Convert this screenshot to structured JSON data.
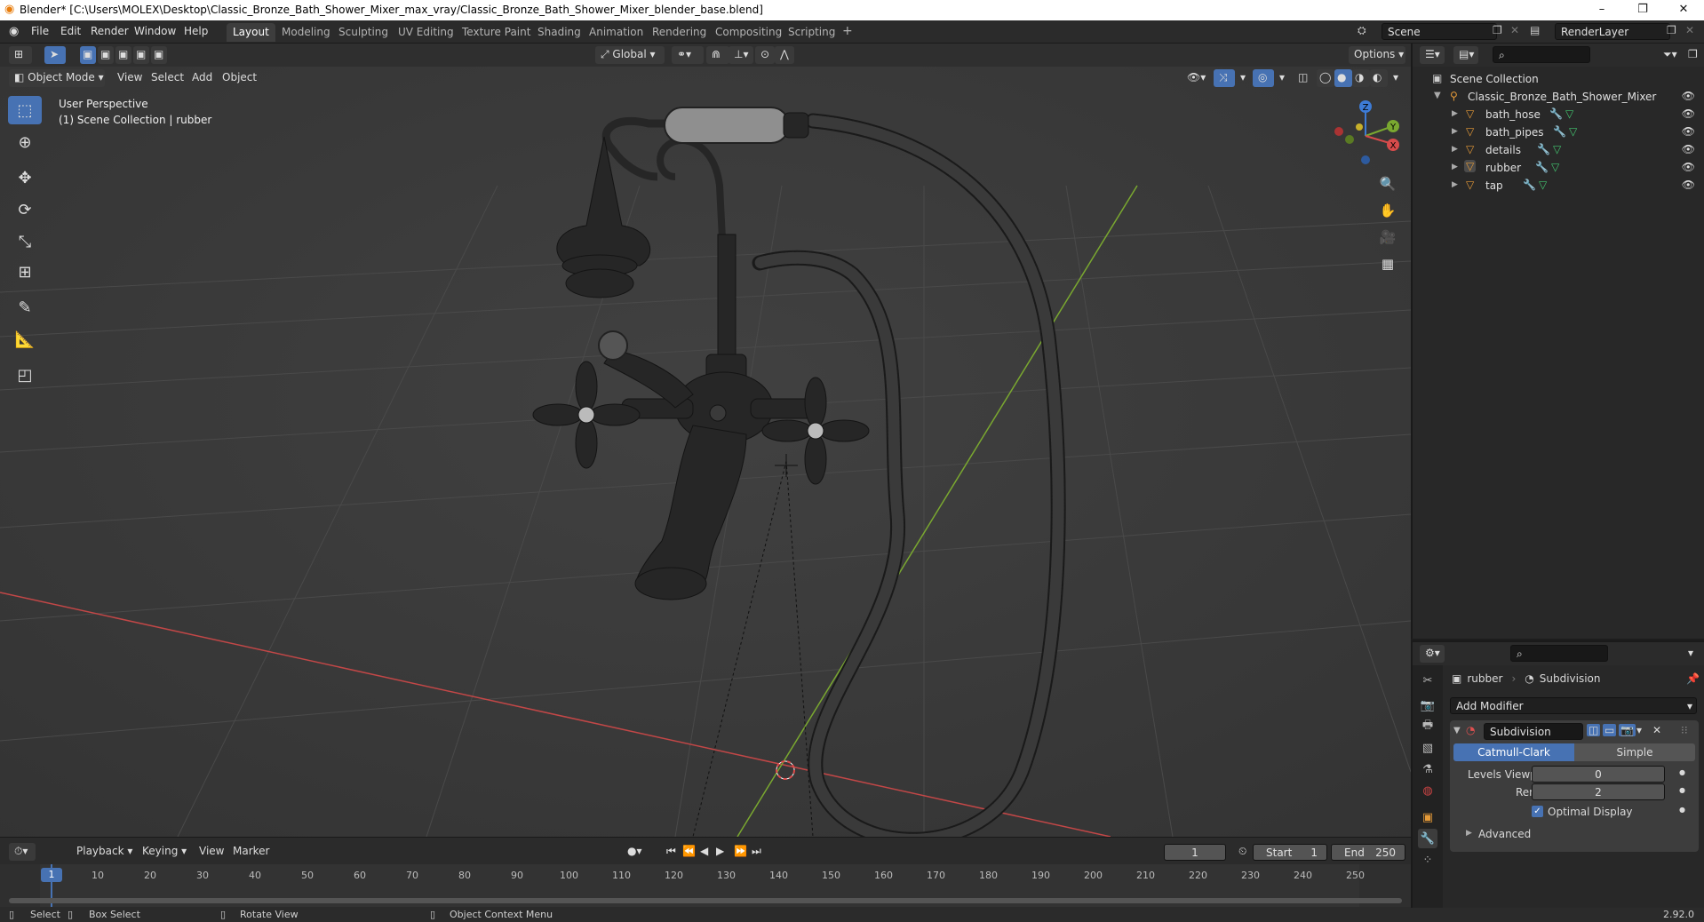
{
  "window": {
    "title": "Blender* [C:\\Users\\MOLEX\\Desktop\\Classic_Bronze_Bath_Shower_Mixer_max_vray/Classic_Bronze_Bath_Shower_Mixer_blender_base.blend]",
    "minimize": "–",
    "maximize": "❐",
    "close": "✕"
  },
  "menu": [
    "File",
    "Edit",
    "Render",
    "Window",
    "Help"
  ],
  "workspaces": [
    "Layout",
    "Modeling",
    "Sculpting",
    "UV Editing",
    "Texture Paint",
    "Shading",
    "Animation",
    "Rendering",
    "Compositing",
    "Scripting"
  ],
  "workspace_add": "+",
  "scene": {
    "name": "Scene",
    "view_layer": "RenderLayer"
  },
  "viewport_header": {
    "transform_orientation": "Global",
    "options_label": "Options",
    "mode": "Object Mode",
    "menus": [
      "View",
      "Select",
      "Add",
      "Object"
    ]
  },
  "viewport_overlay": {
    "perspective": "User Perspective",
    "collection_info": "(1) Scene Collection | rubber"
  },
  "gizmo": {
    "x": "X",
    "y": "Y",
    "z": "Z"
  },
  "outliner": {
    "root": "Scene Collection",
    "collection": "Classic_Bronze_Bath_Shower_Mixer",
    "objects": [
      "bath_hose",
      "bath_pipes",
      "details",
      "rubber",
      "tap"
    ],
    "active_object": "rubber"
  },
  "properties": {
    "object_name": "rubber",
    "modifier_context": "Subdivision",
    "add_modifier": "Add Modifier",
    "modifier": {
      "name": "Subdivision",
      "algorithms": [
        "Catmull-Clark",
        "Simple"
      ],
      "active_algorithm": "Catmull-Clark",
      "levels_viewport_label": "Levels Viewport",
      "levels_viewport": "0",
      "render_label": "Render",
      "render": "2",
      "optimal_display_label": "Optimal Display",
      "optimal_display": true,
      "advanced_label": "Advanced"
    }
  },
  "timeline": {
    "menus": [
      "Playback",
      "Keying",
      "View",
      "Marker"
    ],
    "current_frame": "1",
    "start_label": "Start",
    "start": "1",
    "end_label": "End",
    "end": "250",
    "ruler": [
      "1",
      "10",
      "20",
      "30",
      "40",
      "50",
      "60",
      "70",
      "80",
      "90",
      "100",
      "110",
      "120",
      "130",
      "140",
      "150",
      "160",
      "170",
      "180",
      "190",
      "200",
      "210",
      "220",
      "230",
      "240",
      "250"
    ]
  },
  "statusbar": {
    "select": "Select",
    "box_select": "Box Select",
    "rotate_view": "Rotate View",
    "context_menu": "Object Context Menu",
    "version": "2.92.0"
  },
  "colors": {
    "accent": "#4772b3",
    "x_axis": "#d74b4b",
    "y_axis": "#7aa830",
    "z_axis": "#3d7bd6",
    "mesh_orange": "#e59a38"
  }
}
